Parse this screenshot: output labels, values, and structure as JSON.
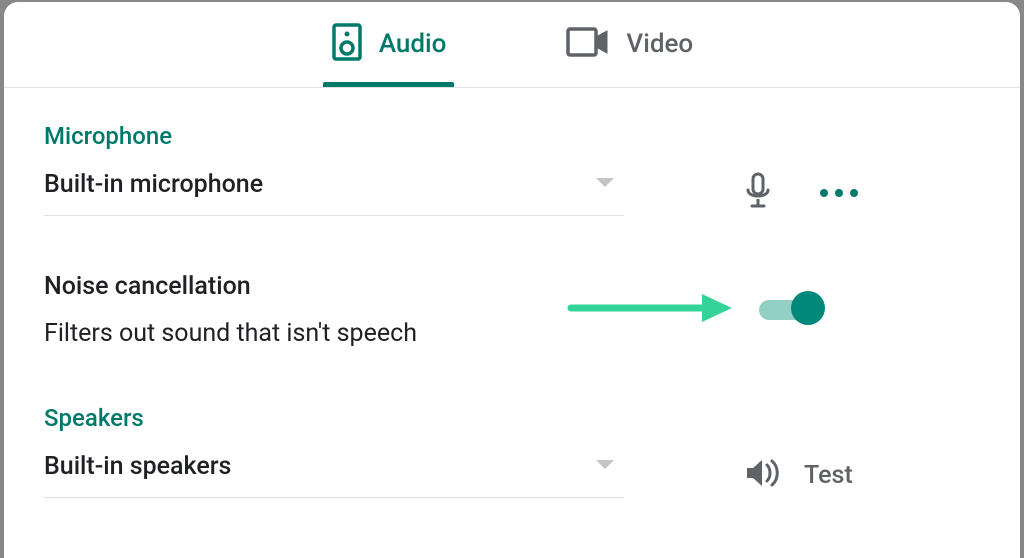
{
  "accent_color": "#00796b",
  "tabs": {
    "audio": {
      "label": "Audio",
      "active": true
    },
    "video": {
      "label": "Video",
      "active": false
    }
  },
  "microphone": {
    "section_label": "Microphone",
    "selected": "Built-in microphone"
  },
  "noise_cancellation": {
    "title": "Noise cancellation",
    "description": "Filters out sound that isn't speech",
    "enabled": true
  },
  "speakers": {
    "section_label": "Speakers",
    "selected": "Built-in speakers",
    "test_label": "Test"
  },
  "annotation": {
    "arrow_color": "#34d399"
  }
}
